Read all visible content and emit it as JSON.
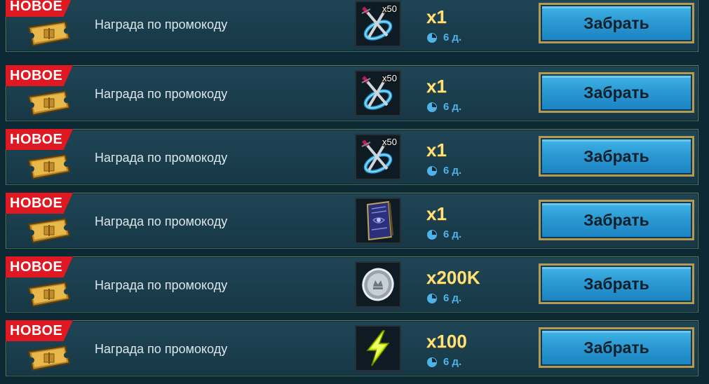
{
  "rewards": [
    {
      "badge": "НОВОЕ",
      "label": "Награда по промокоду",
      "item_icon": "crossed-swords-portal-icon",
      "item_count": "x50",
      "amount": "x1",
      "timer": "6 д.",
      "button": "Забрать"
    },
    {
      "badge": "НОВОЕ",
      "label": "Награда по промокоду",
      "item_icon": "crossed-swords-portal-icon",
      "item_count": "x50",
      "amount": "x1",
      "timer": "6 д.",
      "button": "Забрать"
    },
    {
      "badge": "НОВОЕ",
      "label": "Награда по промокоду",
      "item_icon": "crossed-swords-portal-icon",
      "item_count": "x50",
      "amount": "x1",
      "timer": "6 д.",
      "button": "Забрать"
    },
    {
      "badge": "НОВОЕ",
      "label": "Награда по промокоду",
      "item_icon": "spellbook-icon",
      "item_count": "",
      "amount": "x1",
      "timer": "6 д.",
      "button": "Забрать"
    },
    {
      "badge": "НОВОЕ",
      "label": "Награда по промокоду",
      "item_icon": "silver-coin-icon",
      "item_count": "",
      "amount": "x200K",
      "timer": "6 д.",
      "button": "Забрать"
    },
    {
      "badge": "НОВОЕ",
      "label": "Награда по промокоду",
      "item_icon": "energy-bolt-icon",
      "item_count": "",
      "amount": "x100",
      "timer": "6 д.",
      "button": "Забрать"
    }
  ],
  "colors": {
    "badge": "#e01822",
    "amount": "#ffe07a",
    "timer": "#4fb2e8",
    "button": "#2b9ad4",
    "button_border": "#b59a52"
  }
}
